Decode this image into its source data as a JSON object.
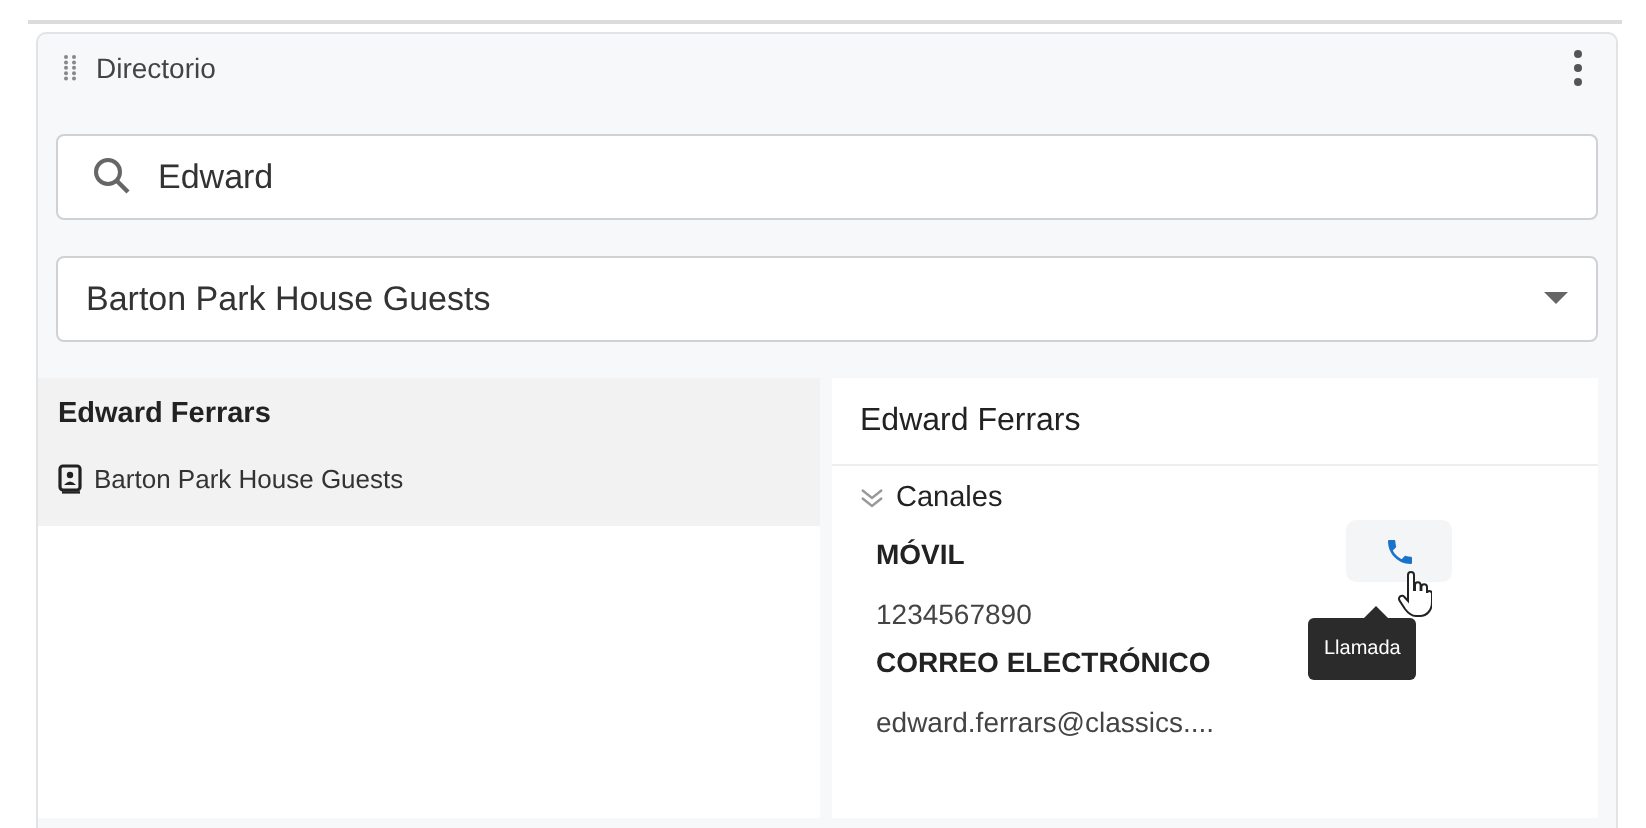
{
  "panel": {
    "title": "Directorio"
  },
  "search": {
    "value": "Edward"
  },
  "directory_select": {
    "value": "Barton Park House Guests"
  },
  "results": [
    {
      "name": "Edward Ferrars",
      "directory": "Barton Park House Guests",
      "selected": true
    }
  ],
  "detail": {
    "name": "Edward Ferrars",
    "section": {
      "title": "Canales",
      "expanded": true
    },
    "channels": [
      {
        "kind": "phone",
        "label": "MÓVIL",
        "value": "1234567890",
        "action_tooltip": "Llamada"
      },
      {
        "kind": "email",
        "label": "CORREO ELECTRÓNICO",
        "value": "edward.ferrars@classics...."
      }
    ]
  }
}
